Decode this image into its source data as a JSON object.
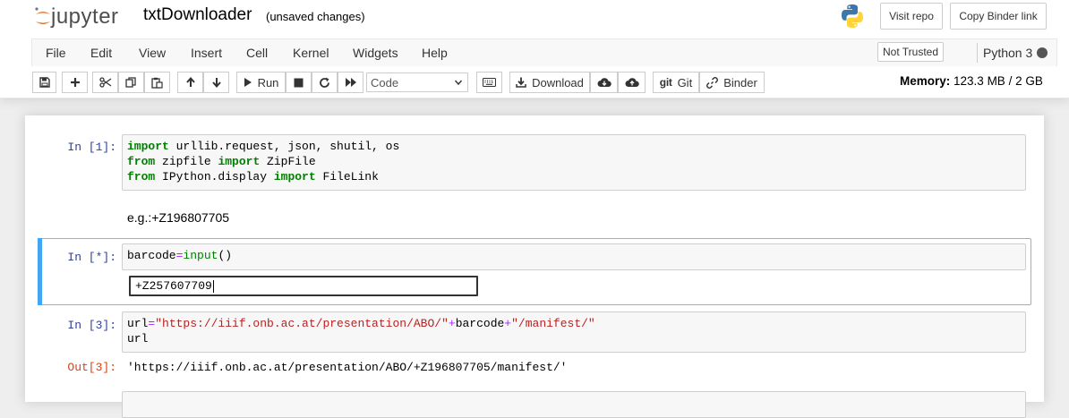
{
  "header": {
    "logo_text": "jupyter",
    "notebook_title": "txtDownloader",
    "save_status": "(unsaved changes)",
    "visit_repo_label": "Visit repo",
    "copy_binder_label": "Copy Binder link"
  },
  "menubar": {
    "items": [
      "File",
      "Edit",
      "View",
      "Insert",
      "Cell",
      "Kernel",
      "Widgets",
      "Help"
    ],
    "trusted_label": "Not Trusted",
    "kernel_name": "Python 3"
  },
  "toolbar": {
    "run_label": "Run",
    "cell_type_value": "Code",
    "download_label": "Download",
    "git_icon_text": "git",
    "git_label": "Git",
    "binder_label": "Binder",
    "memory_label": "Memory:",
    "memory_value": "123.3 MB / 2 GB"
  },
  "cells": {
    "c1": {
      "prompt": "In [1]:",
      "lines": [
        {
          "kw1": "import",
          "rest": " urllib.request, json, shutil, os"
        },
        {
          "kw1": "from",
          "mid": " zipfile ",
          "kw2": "import",
          "rest": " ZipFile"
        },
        {
          "kw1": "from",
          "mid": " IPython.display ",
          "kw2": "import",
          "rest": " FileLink"
        }
      ]
    },
    "md1": {
      "text": "e.g.:+Z196807705"
    },
    "c2": {
      "prompt": "In [*]:",
      "var": "barcode",
      "op": "=",
      "fn": "input",
      "paren": "()",
      "stdin_value": "+Z257607709"
    },
    "c3": {
      "prompt": "In [3]:",
      "l1_var": "url",
      "l1_op1": "=",
      "l1_str1": "\"https://iiif.onb.ac.at/presentation/ABO/\"",
      "l1_op2": "+",
      "l1_mid": "barcode",
      "l1_op3": "+",
      "l1_str2": "\"/manifest/\"",
      "l2": "url",
      "out_prompt": "Out[3]:",
      "out_text": "'https://iiif.onb.ac.at/presentation/ABO/+Z196807705/manifest/'"
    }
  },
  "colors": {
    "accent_selected": "#42a5f5",
    "prompt_in": "#303f9f",
    "prompt_out": "#d84315",
    "keyword": "#008000",
    "string": "#ba2121"
  }
}
